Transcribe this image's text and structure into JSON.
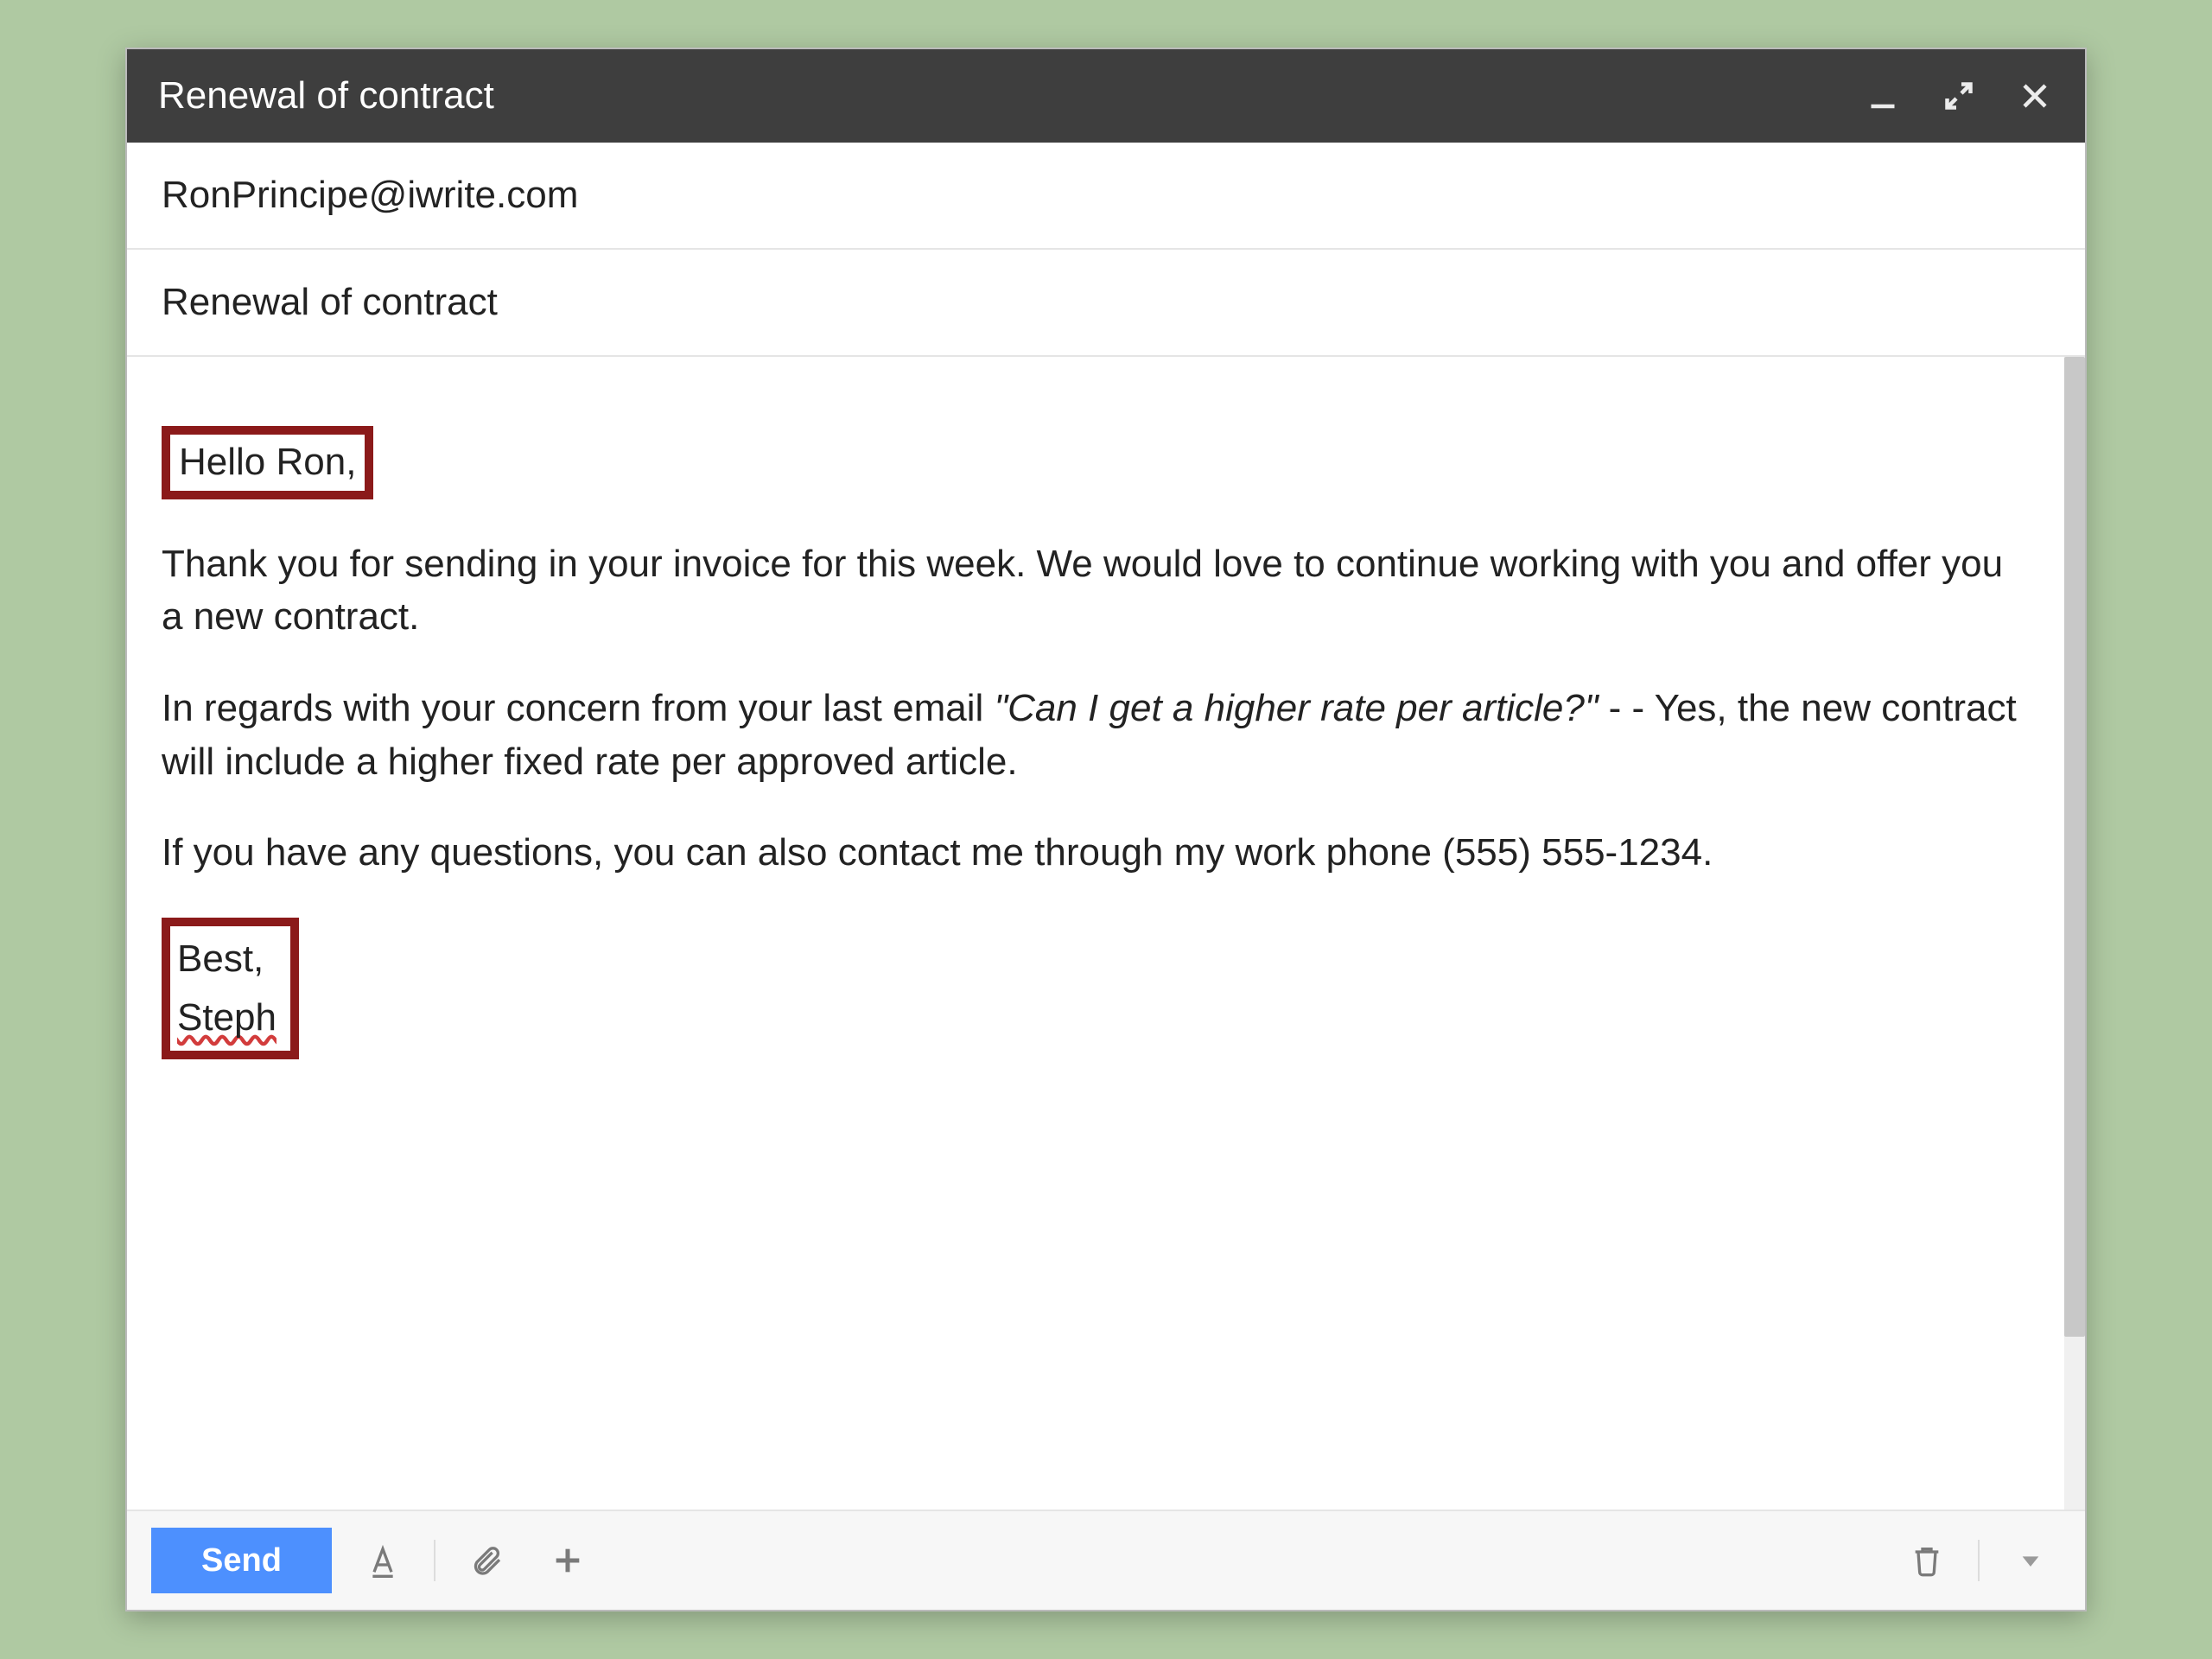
{
  "titlebar": {
    "title": "Renewal of contract"
  },
  "fields": {
    "to": "RonPrincipe@iwrite.com",
    "subject": "Renewal of contract"
  },
  "body": {
    "greeting": "Hello Ron,",
    "para1": "Thank you for sending in your invoice for this week. We would love to continue working with you and offer you a new contract.",
    "para2_a": "In regards with your concern from your last email ",
    "para2_quote": "\"Can I get a higher rate per article?\"",
    "para2_b": " - - Yes, the new contract will include a higher fixed rate per approved article.",
    "para3": "If you have any questions, you can also contact me through my work phone (555) 555-1234.",
    "signoff": "Best,",
    "name": "Steph"
  },
  "toolbar": {
    "send_label": "Send"
  }
}
